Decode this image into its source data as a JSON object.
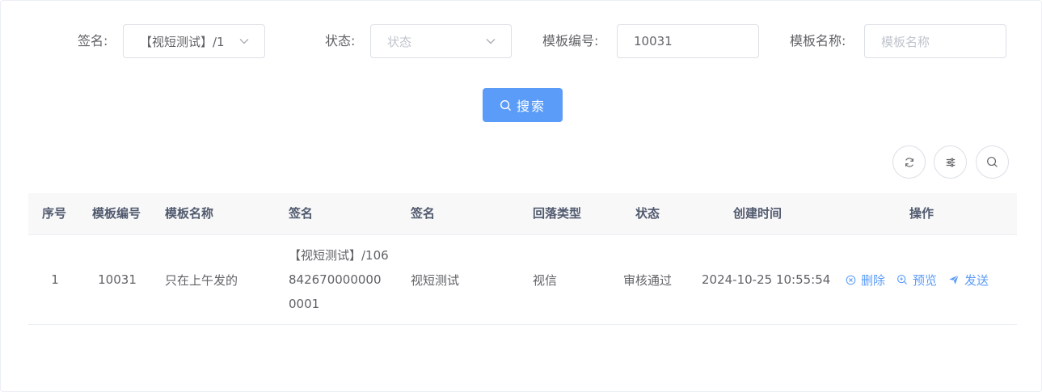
{
  "filters": {
    "sign": {
      "label": "签名:",
      "value": "【视短测试】/1"
    },
    "status": {
      "label": "状态:",
      "placeholder": "状态"
    },
    "template_id": {
      "label": "模板编号:",
      "value": "10031"
    },
    "template_name": {
      "label": "模板名称:",
      "placeholder": "模板名称"
    }
  },
  "search_button": {
    "label": "搜索",
    "icon": "search-icon"
  },
  "toolbar": {
    "icons": [
      "refresh-icon",
      "sliders-icon",
      "search-icon"
    ]
  },
  "table": {
    "columns": [
      "序号",
      "模板编号",
      "模板名称",
      "签名",
      "签名",
      "回落类型",
      "状态",
      "创建时间",
      "操作"
    ],
    "rows": [
      {
        "index": "1",
        "template_id": "10031",
        "template_name": "只在上午发的",
        "sign_full": "【视短测试】/1068426700000000001",
        "sign_name": "视短测试",
        "fallback_type": "视信",
        "status": "审核通过",
        "created_at": "2024-10-25 10:55:54",
        "actions": {
          "delete": "删除",
          "preview": "预览",
          "send": "发送"
        }
      }
    ]
  },
  "colors": {
    "primary": "#5b9cf8",
    "border": "#dcdfe6",
    "header_bg": "#f8f8f9"
  }
}
